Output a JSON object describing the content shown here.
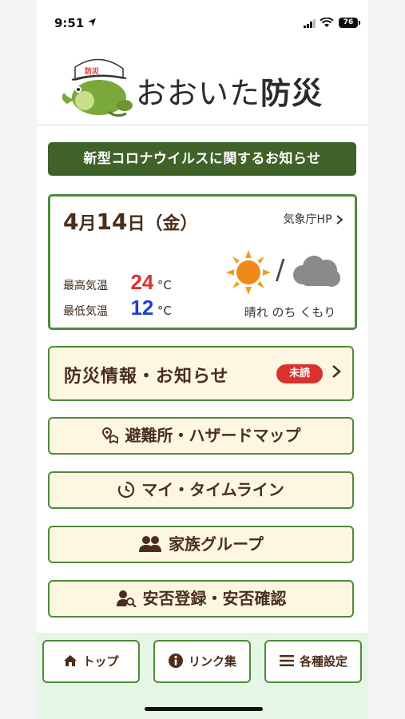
{
  "status_bar": {
    "time": "9:51",
    "battery": "76"
  },
  "header": {
    "logo_text_kana": "おおいた",
    "logo_text_kanji": "防災",
    "helmet_text": "防災"
  },
  "notice": {
    "label": "新型コロナウイルスに関するお知らせ"
  },
  "weather": {
    "date_month": "4",
    "date_month_unit": "月",
    "date_day": "14",
    "date_day_unit": "日",
    "weekday": "（金）",
    "jma_link": "気象庁HP",
    "high_label": "最高気温",
    "high_value": "24",
    "low_label": "最低気温",
    "low_value": "12",
    "temp_unit": "°C",
    "forecast": "晴れ のち くもり"
  },
  "menu": {
    "disaster_info": "防災情報・お知らせ",
    "unread_badge": "未読",
    "evacuation": "避難所・ハザードマップ",
    "timeline": "マイ・タイムライン",
    "family": "家族グループ",
    "safety": "安否登録・安否確認"
  },
  "tabs": {
    "top": "トップ",
    "links": "リンク集",
    "settings": "各種設定"
  },
  "colors": {
    "accent_green": "#4f8a3a",
    "notice_bg": "#3f6228",
    "high_temp": "#e0302a",
    "low_temp": "#1f3fd0",
    "unread": "#d9312c",
    "button_bg": "#fdf7e2"
  }
}
